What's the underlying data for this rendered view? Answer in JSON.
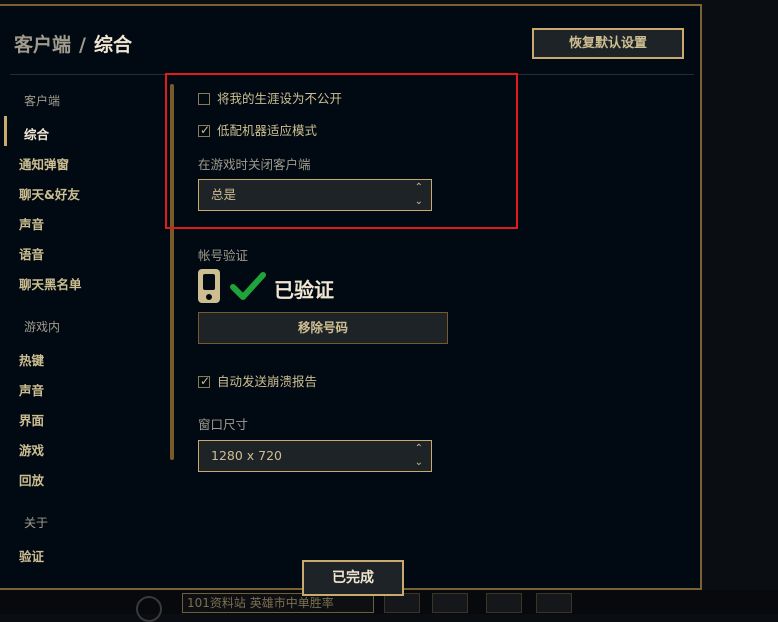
{
  "header": {
    "breadcrumb_parent": "客户端",
    "breadcrumb_separator": "/",
    "breadcrumb_current": "综合",
    "restore_defaults_label": "恢复默认设置"
  },
  "sidebar": {
    "groups": [
      {
        "label": "客户端",
        "items": [
          "综合",
          "通知弹窗",
          "聊天&好友",
          "声音",
          "语音",
          "聊天黑名单"
        ]
      },
      {
        "label": "游戏内",
        "items": [
          "热键",
          "声音",
          "界面",
          "游戏",
          "回放"
        ]
      },
      {
        "label": "关于",
        "items": [
          "验证"
        ]
      }
    ],
    "active_item": "综合"
  },
  "settings": {
    "private_career": {
      "label": "将我的生涯设为不公开",
      "checked": false
    },
    "low_spec_mode": {
      "label": "低配机器适应模式",
      "checked": true
    },
    "close_client": {
      "label": "在游戏时关闭客户端",
      "value": "总是",
      "arrow_up": "⌃",
      "arrow_down": "⌄"
    },
    "account_verification": {
      "label": "帐号验证",
      "status": "已验证",
      "remove_button": "移除号码",
      "phone_icon": "phone-icon",
      "check_icon": "check-icon"
    },
    "auto_crash_report": {
      "label": "自动发送崩溃报告",
      "checked": true
    },
    "window_size": {
      "label": "窗口尺寸",
      "value": "1280 x 720"
    }
  },
  "footer": {
    "done_label": "已完成"
  },
  "background": {
    "strip_text": "101资料站 英雄市中单胜率"
  },
  "colors": {
    "gold": "#c8aa6e",
    "gold_text": "#cdbe91",
    "highlight_red": "#e01b1b",
    "check_green": "#1fa33a",
    "panel_bg": "#010a13"
  }
}
